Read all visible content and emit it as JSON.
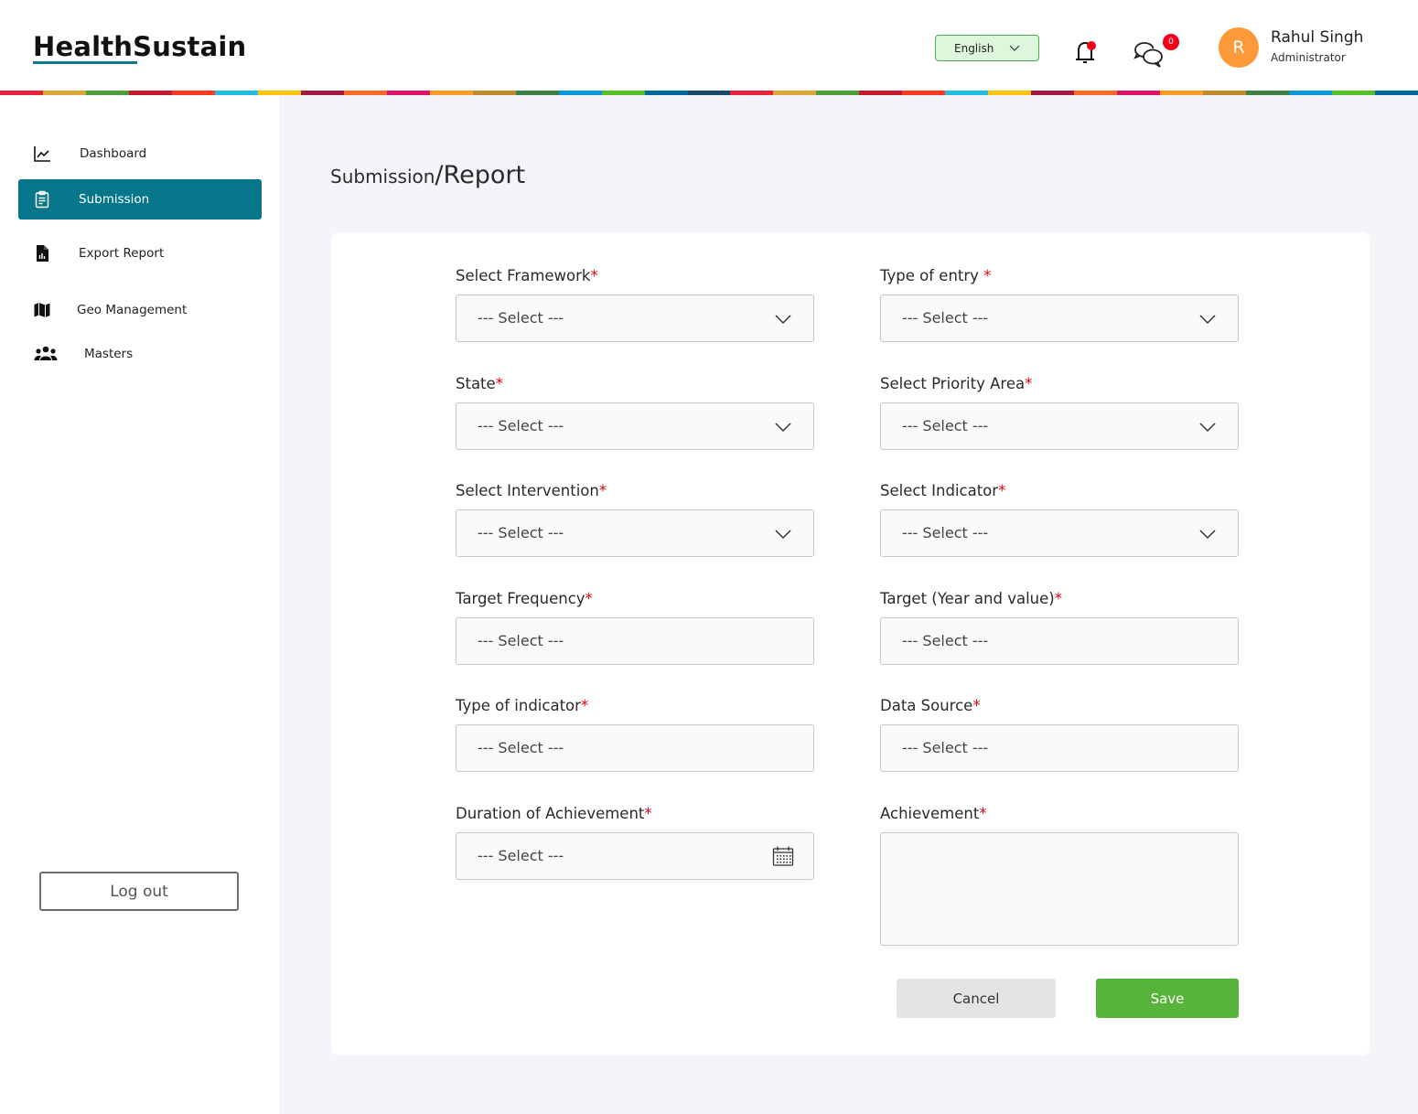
{
  "header": {
    "logo": "HealthSustain",
    "language": "English",
    "chat_badge_count": "0",
    "user": {
      "initial": "R",
      "name": "Rahul Singh",
      "role": "Administrator"
    }
  },
  "stripe_colors": [
    "#e5243b",
    "#dda63a",
    "#4c9f38",
    "#c5192d",
    "#ff3a21",
    "#26bde2",
    "#fcc30b",
    "#a21942",
    "#fd6925",
    "#dd1367",
    "#fd9d24",
    "#bf8b2e",
    "#3f7e44",
    "#0a97d9",
    "#56c02b",
    "#00689d",
    "#19486a",
    "#e5243b",
    "#dda63a",
    "#4c9f38",
    "#c5192d",
    "#ff3a21",
    "#26bde2",
    "#fcc30b",
    "#a21942",
    "#fd6925",
    "#dd1367",
    "#fd9d24",
    "#bf8b2e",
    "#3f7e44",
    "#0a97d9",
    "#56c02b",
    "#00689d"
  ],
  "sidebar": {
    "items": [
      {
        "label": "Dashboard",
        "icon": "chart-line-icon"
      },
      {
        "label": "Submission",
        "icon": "clipboard-icon",
        "active": true
      },
      {
        "label": "Export Report",
        "icon": "file-report-icon"
      },
      {
        "label": "Geo Management",
        "icon": "map-icon"
      },
      {
        "label": "Masters",
        "icon": "users-icon"
      }
    ],
    "logout_label": "Log out"
  },
  "breadcrumb": {
    "parent": "Submission",
    "separator": "/",
    "current": "Report"
  },
  "form": {
    "required_mark": "*",
    "placeholder": "--- Select ---",
    "fields": {
      "framework": {
        "label": "Select Framework",
        "value": "--- Select ---"
      },
      "type_of_entry": {
        "label": "Type of entry ",
        "value": "--- Select ---"
      },
      "state": {
        "label": "State",
        "value": "--- Select ---"
      },
      "priority_area": {
        "label": "Select Priority Area",
        "value": "--- Select ---"
      },
      "intervention": {
        "label": "Select Intervention",
        "value": "--- Select ---"
      },
      "indicator": {
        "label": "Select Indicator",
        "value": "--- Select ---"
      },
      "target_frequency": {
        "label": "Target Frequency",
        "value": "--- Select ---"
      },
      "target_year_value": {
        "label": "Target (Year and value)",
        "value": "--- Select ---"
      },
      "type_of_indicator": {
        "label": "Type of indicator",
        "value": "--- Select ---"
      },
      "data_source": {
        "label": "Data Source",
        "value": "--- Select ---"
      },
      "duration": {
        "label": "Duration of Achievement",
        "value": "--- Select ---"
      },
      "achievement": {
        "label": "Achievement",
        "value": ""
      }
    },
    "cancel_label": "Cancel",
    "save_label": "Save"
  }
}
